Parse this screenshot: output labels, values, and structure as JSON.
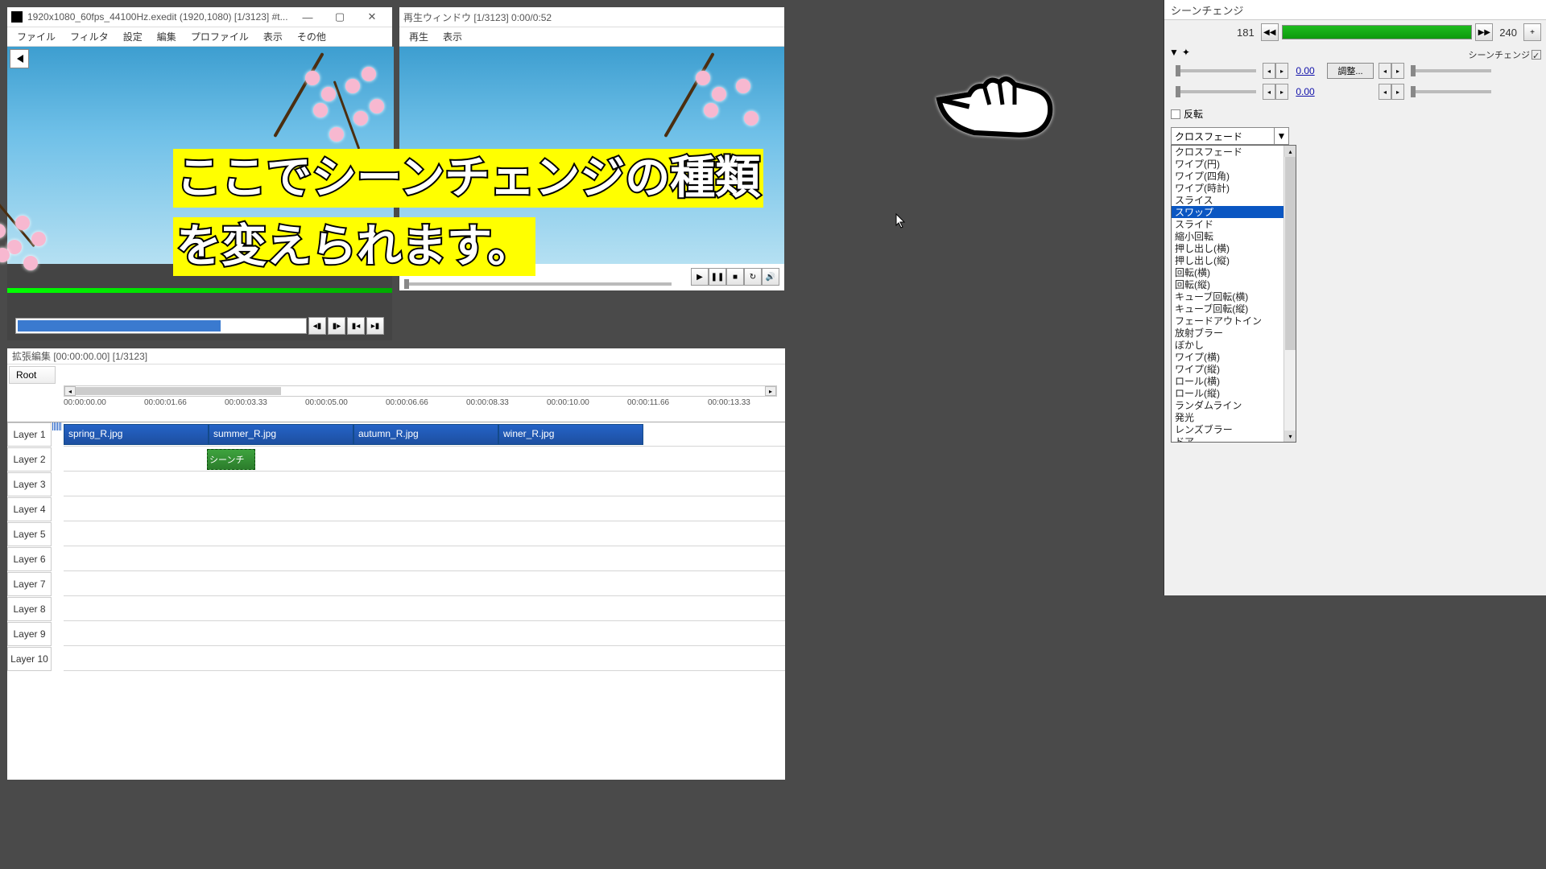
{
  "editor": {
    "title": "1920x1080_60fps_44100Hz.exedit (1920,1080) [1/3123] #t...",
    "menus": [
      "ファイル",
      "フィルタ",
      "設定",
      "編集",
      "プロファイル",
      "表示",
      "その他"
    ]
  },
  "playback": {
    "title": "再生ウィンドウ  [1/3123]  0:00/0:52",
    "menus": [
      "再生",
      "表示"
    ]
  },
  "overlay": {
    "line1": "ここでシーンチェンジの種類",
    "line2": "を変えられます。"
  },
  "timeline": {
    "title": "拡張編集 [00:00:00.00] [1/3123]",
    "root": "Root",
    "ruler": [
      "00:00:00.00",
      "00:00:01.66",
      "00:00:03.33",
      "00:00:05.00",
      "00:00:06.66",
      "00:00:08.33",
      "00:00:10.00",
      "00:00:11.66",
      "00:00:13.33"
    ],
    "layers": [
      "Layer 1",
      "Layer 2",
      "Layer 3",
      "Layer 4",
      "Layer 5",
      "Layer 6",
      "Layer 7",
      "Layer 8",
      "Layer 9",
      "Layer 10"
    ],
    "clips": [
      {
        "layer": 0,
        "label": "spring_R.jpg",
        "start": 0,
        "end": 180
      },
      {
        "layer": 0,
        "label": "summer_R.jpg",
        "start": 180,
        "end": 360
      },
      {
        "layer": 0,
        "label": "autumn_R.jpg",
        "start": 360,
        "end": 540
      },
      {
        "layer": 0,
        "label": "winer_R.jpg",
        "start": 540,
        "end": 720
      }
    ],
    "scene_clip": {
      "layer": 1,
      "label": "シーンチェン",
      "start": 178,
      "end": 238
    }
  },
  "scenechange": {
    "title": "シーンチェンジ",
    "frame_cur": "181",
    "frame_end": "240",
    "chk_label": "シーンチェンジ",
    "param_val1": "0.00",
    "param_btn": "調整...",
    "param_val2": "0.00",
    "reverse": "反転",
    "selected": "クロスフェード",
    "options": [
      "クロスフェード",
      "ワイプ(円)",
      "ワイプ(四角)",
      "ワイプ(時計)",
      "スライス",
      "スワップ",
      "スライド",
      "縮小回転",
      "押し出し(横)",
      "押し出し(縦)",
      "回転(横)",
      "回転(縦)",
      "キューブ回転(横)",
      "キューブ回転(縦)",
      "フェードアウトイン",
      "放射ブラー",
      "ぼかし",
      "ワイプ(横)",
      "ワイプ(縦)",
      "ロール(横)",
      "ロール(縦)",
      "ランダムライン",
      "発光",
      "レンズブラー",
      "ドア"
    ],
    "highlighted": 5
  }
}
